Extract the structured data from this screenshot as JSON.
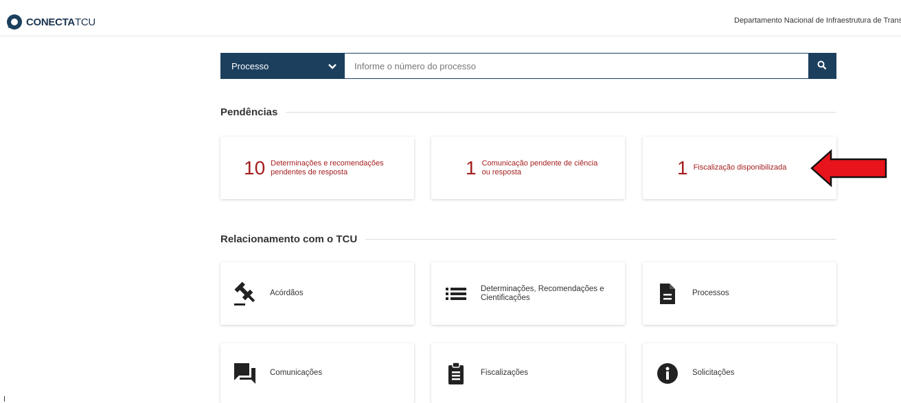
{
  "header": {
    "logo_bold": "CONECTA",
    "logo_light": "TCU",
    "department": "Departamento Nacional de Infraestrutura de Transp"
  },
  "search": {
    "select_label": "Processo",
    "placeholder": "Informe o número do processo"
  },
  "pendencias": {
    "title": "Pendências",
    "items": [
      {
        "count": "10",
        "label_line1": "Determinações e recomendações",
        "label_line2": "pendentes de resposta"
      },
      {
        "count": "1",
        "label_line1": "Comunicação pendente de ciência",
        "label_line2": "ou resposta"
      },
      {
        "count": "1",
        "label_line1": "Fiscalização disponibilizada",
        "label_line2": ""
      }
    ]
  },
  "relacionamento": {
    "title": "Relacionamento com o TCU",
    "items": [
      {
        "icon": "gavel-icon",
        "label_line1": "Acórdãos",
        "label_line2": ""
      },
      {
        "icon": "list-icon",
        "label_line1": "Determinações, Recomendações e",
        "label_line2": "Cientificações"
      },
      {
        "icon": "document-icon",
        "label_line1": "Processos",
        "label_line2": ""
      },
      {
        "icon": "chat-icon",
        "label_line1": "Comunicações",
        "label_line2": ""
      },
      {
        "icon": "clipboard-icon",
        "label_line1": "Fiscalizações",
        "label_line2": ""
      },
      {
        "icon": "info-icon",
        "label_line1": "Solicitações",
        "label_line2": ""
      }
    ]
  },
  "colors": {
    "brand": "#1c3f5e",
    "pending_red": "#a41d1d",
    "arrow_red": "#e8141b"
  }
}
